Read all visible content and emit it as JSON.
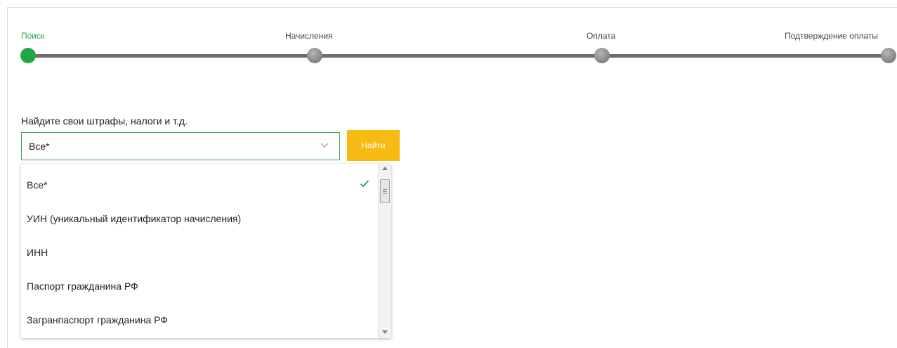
{
  "stepper": {
    "steps": [
      {
        "label": "Поиск",
        "active": true
      },
      {
        "label": "Начисления",
        "active": false
      },
      {
        "label": "Оплата",
        "active": false
      },
      {
        "label": "Подтверждение оплаты",
        "active": false
      }
    ]
  },
  "search": {
    "title": "Найдите свои штрафы, налоги и т.д.",
    "selected_value": "Все*",
    "find_button_label": "Найти"
  },
  "dropdown": {
    "options": [
      {
        "label": "Все*",
        "selected": true
      },
      {
        "label": "УИН (уникальный идентификатор начисления)",
        "selected": false
      },
      {
        "label": "ИНН",
        "selected": false
      },
      {
        "label": "Паспорт гражданина РФ",
        "selected": false
      },
      {
        "label": "Загранпаспорт гражданина РФ",
        "selected": false
      }
    ]
  },
  "colors": {
    "accent_green": "#1fa84a",
    "button_yellow": "#f7bb14",
    "inactive_step": "#8d8d8d",
    "track": "#6e6e6e"
  },
  "icons": {
    "select_chevron": "chevron-down-icon",
    "selected_mark": "check-icon",
    "scroll_up": "scroll-up-arrow-icon",
    "scroll_down": "scroll-down-arrow-icon"
  }
}
